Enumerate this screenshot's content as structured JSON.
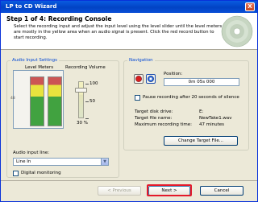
{
  "window": {
    "title": "LP to CD Wizard",
    "close_glyph": "X"
  },
  "header": {
    "step_title": "Step 1 of 4: Recording Console",
    "description": "Select the recording input and adjust the input level using the level slider until the level meters are mostly in the yellow area when an audio signal is present. Click the red record button to start recording."
  },
  "audio": {
    "group_label": "Audio Input Settings",
    "level_meters_label": "Level Meters",
    "recording_volume_label": "Recording Volume",
    "scale": [
      "100",
      "50",
      "30 %"
    ],
    "input_line_label": "Audio input line:",
    "input_line_value": "Line In",
    "digital_monitoring_label": "Digital monitoring",
    "digital_monitoring_checked": false
  },
  "navigation": {
    "group_label": "Navigation",
    "position_label": "Position:",
    "position_value": "0m 05s 000",
    "pause_label": "Pause recording after 20 seconds of silence",
    "pause_checked": false,
    "target_disk_label": "Target disk drive:",
    "target_disk_value": "E:",
    "target_file_label": "Target file name:",
    "target_file_value": "NewTake1.wav",
    "max_time_label": "Maximum recording time:",
    "max_time_value": "47 minutes",
    "change_target_label": "Change Target File..."
  },
  "footer": {
    "previous_label": "< Previous",
    "next_label": "Next >",
    "cancel_label": "Cancel"
  },
  "colors": {
    "highlight": "#e4192a",
    "group_label": "#0046d5",
    "record": "#d81f1f",
    "stop": "#1f5fd8"
  }
}
